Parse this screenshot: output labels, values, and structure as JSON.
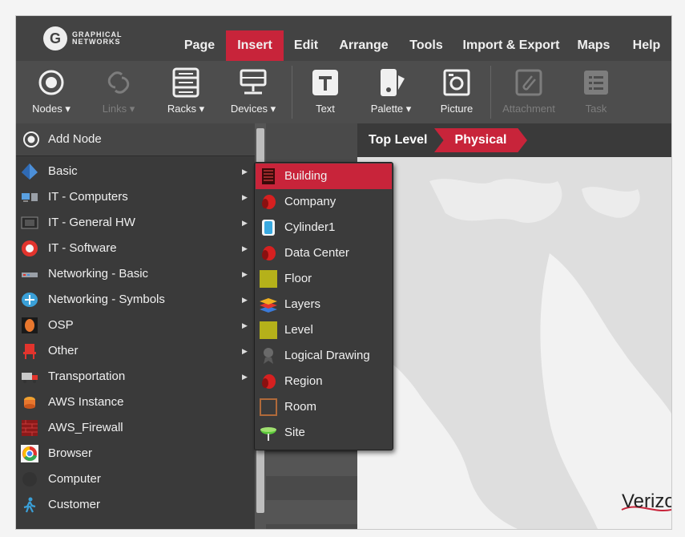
{
  "brand": {
    "name_line1": "GRAPHICAL",
    "name_line2": "NETWORKS"
  },
  "menubar": {
    "items": [
      {
        "label": "Page"
      },
      {
        "label": "Insert",
        "active": true
      },
      {
        "label": "Edit"
      },
      {
        "label": "Arrange"
      },
      {
        "label": "Tools"
      },
      {
        "label": "Import & Export"
      },
      {
        "label": "Maps"
      },
      {
        "label": "Help"
      }
    ]
  },
  "toolbar": {
    "tools": [
      {
        "label": "Nodes ▾",
        "icon": "nodes-icon",
        "enabled": true
      },
      {
        "label": "Links ▾",
        "icon": "links-icon",
        "enabled": false
      },
      {
        "label": "Racks ▾",
        "icon": "racks-icon",
        "enabled": true
      },
      {
        "label": "Devices ▾",
        "icon": "devices-icon",
        "enabled": true
      },
      {
        "label": "Text",
        "icon": "text-icon",
        "enabled": true
      },
      {
        "label": "Palette ▾",
        "icon": "palette-icon",
        "enabled": true
      },
      {
        "label": "Picture",
        "icon": "picture-icon",
        "enabled": true
      },
      {
        "label": "Attachment",
        "icon": "attachment-icon",
        "enabled": false
      },
      {
        "label": "Task",
        "icon": "task-icon",
        "enabled": false
      }
    ]
  },
  "nodes_menu": {
    "add_node": "Add Node",
    "items": [
      {
        "label": "Basic",
        "icon": "pyramid-icon",
        "submenu": true
      },
      {
        "label": "IT - Computers",
        "icon": "computers-icon",
        "submenu": true
      },
      {
        "label": "IT - General HW",
        "icon": "hardware-icon",
        "submenu": true
      },
      {
        "label": "IT - Software",
        "icon": "software-icon",
        "submenu": true
      },
      {
        "label": "Networking - Basic",
        "icon": "network-device-icon",
        "submenu": true
      },
      {
        "label": "Networking - Symbols",
        "icon": "router-icon",
        "submenu": true
      },
      {
        "label": "OSP",
        "icon": "osp-icon",
        "submenu": true
      },
      {
        "label": "Other",
        "icon": "chair-icon",
        "submenu": true
      },
      {
        "label": "Transportation",
        "icon": "truck-icon",
        "submenu": true
      },
      {
        "label": "AWS Instance",
        "icon": "aws-instance-icon",
        "submenu": false
      },
      {
        "label": "AWS_Firewall",
        "icon": "firewall-icon",
        "submenu": false
      },
      {
        "label": "Browser",
        "icon": "browser-icon",
        "submenu": false
      },
      {
        "label": "Computer",
        "icon": "computer-icon",
        "submenu": false
      },
      {
        "label": "Customer",
        "icon": "customer-icon",
        "submenu": false
      }
    ]
  },
  "basic_submenu": {
    "items": [
      {
        "label": "Building",
        "icon": "building-icon",
        "active": true
      },
      {
        "label": "Company",
        "icon": "company-icon"
      },
      {
        "label": "Cylinder1",
        "icon": "cylinder-icon"
      },
      {
        "label": "Data Center",
        "icon": "data-center-icon"
      },
      {
        "label": "Floor",
        "icon": "floor-icon"
      },
      {
        "label": "Layers",
        "icon": "layers-icon"
      },
      {
        "label": "Level",
        "icon": "level-icon"
      },
      {
        "label": "Logical Drawing",
        "icon": "logical-drawing-icon"
      },
      {
        "label": "Region",
        "icon": "region-icon"
      },
      {
        "label": "Room",
        "icon": "room-icon"
      },
      {
        "label": "Site",
        "icon": "site-icon"
      }
    ]
  },
  "breadcrumb": {
    "level1": "Top Level",
    "level2": "Physical"
  },
  "canvas": {
    "map_label": "Verizo"
  },
  "colors": {
    "accent": "#c8243a",
    "menubar": "#434343",
    "toolbar": "#4d4d4d",
    "panel": "#3a3a3a",
    "canvas": "#dedede"
  }
}
